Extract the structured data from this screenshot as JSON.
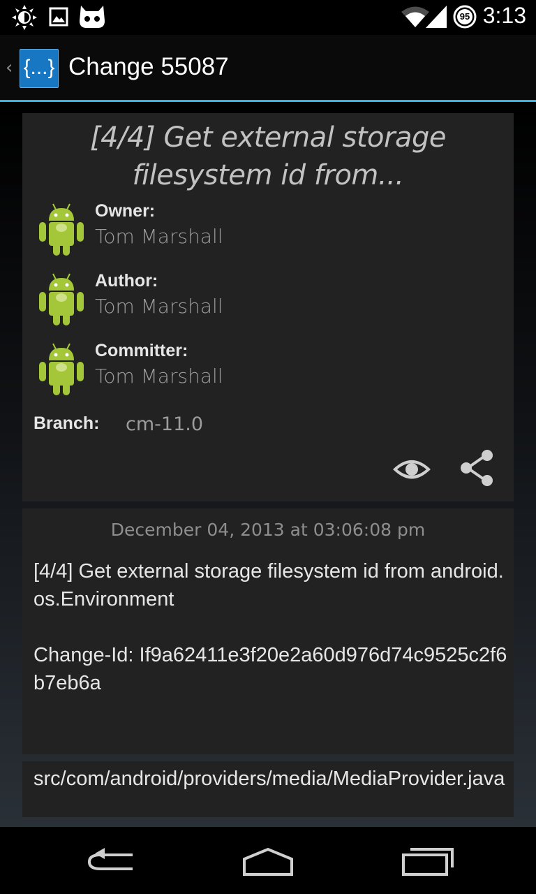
{
  "status_bar": {
    "time": "3:13",
    "battery_level": "95",
    "icons": [
      "brightness-icon",
      "image-notification-icon",
      "cyanogenmod-icon",
      "wifi-icon",
      "signal-icon",
      "battery-icon"
    ]
  },
  "action_bar": {
    "app_icon_text": "{...}",
    "title": "Change 55087"
  },
  "change": {
    "subject_short": "[4/4] Get external storage filesystem id from...",
    "people": [
      {
        "label": "Owner:",
        "name": "Tom Marshall"
      },
      {
        "label": "Author:",
        "name": "Tom Marshall"
      },
      {
        "label": "Committer:",
        "name": "Tom Marshall"
      }
    ],
    "branch_label": "Branch:",
    "branch": "cm-11.0",
    "date": "December 04, 2013 at 03:06:08 pm",
    "message": "[4/4] Get external storage filesystem id from android.os.Environment\n\nChange-Id: If9a62411e3f20e2a60d976d74c9525c2f6b7eb6a",
    "file_path": "src/com/android/providers/media/MediaProvider.java"
  },
  "colors": {
    "accent": "#33b5e5",
    "card_bg": "#222222",
    "android_green": "#a4c639"
  }
}
